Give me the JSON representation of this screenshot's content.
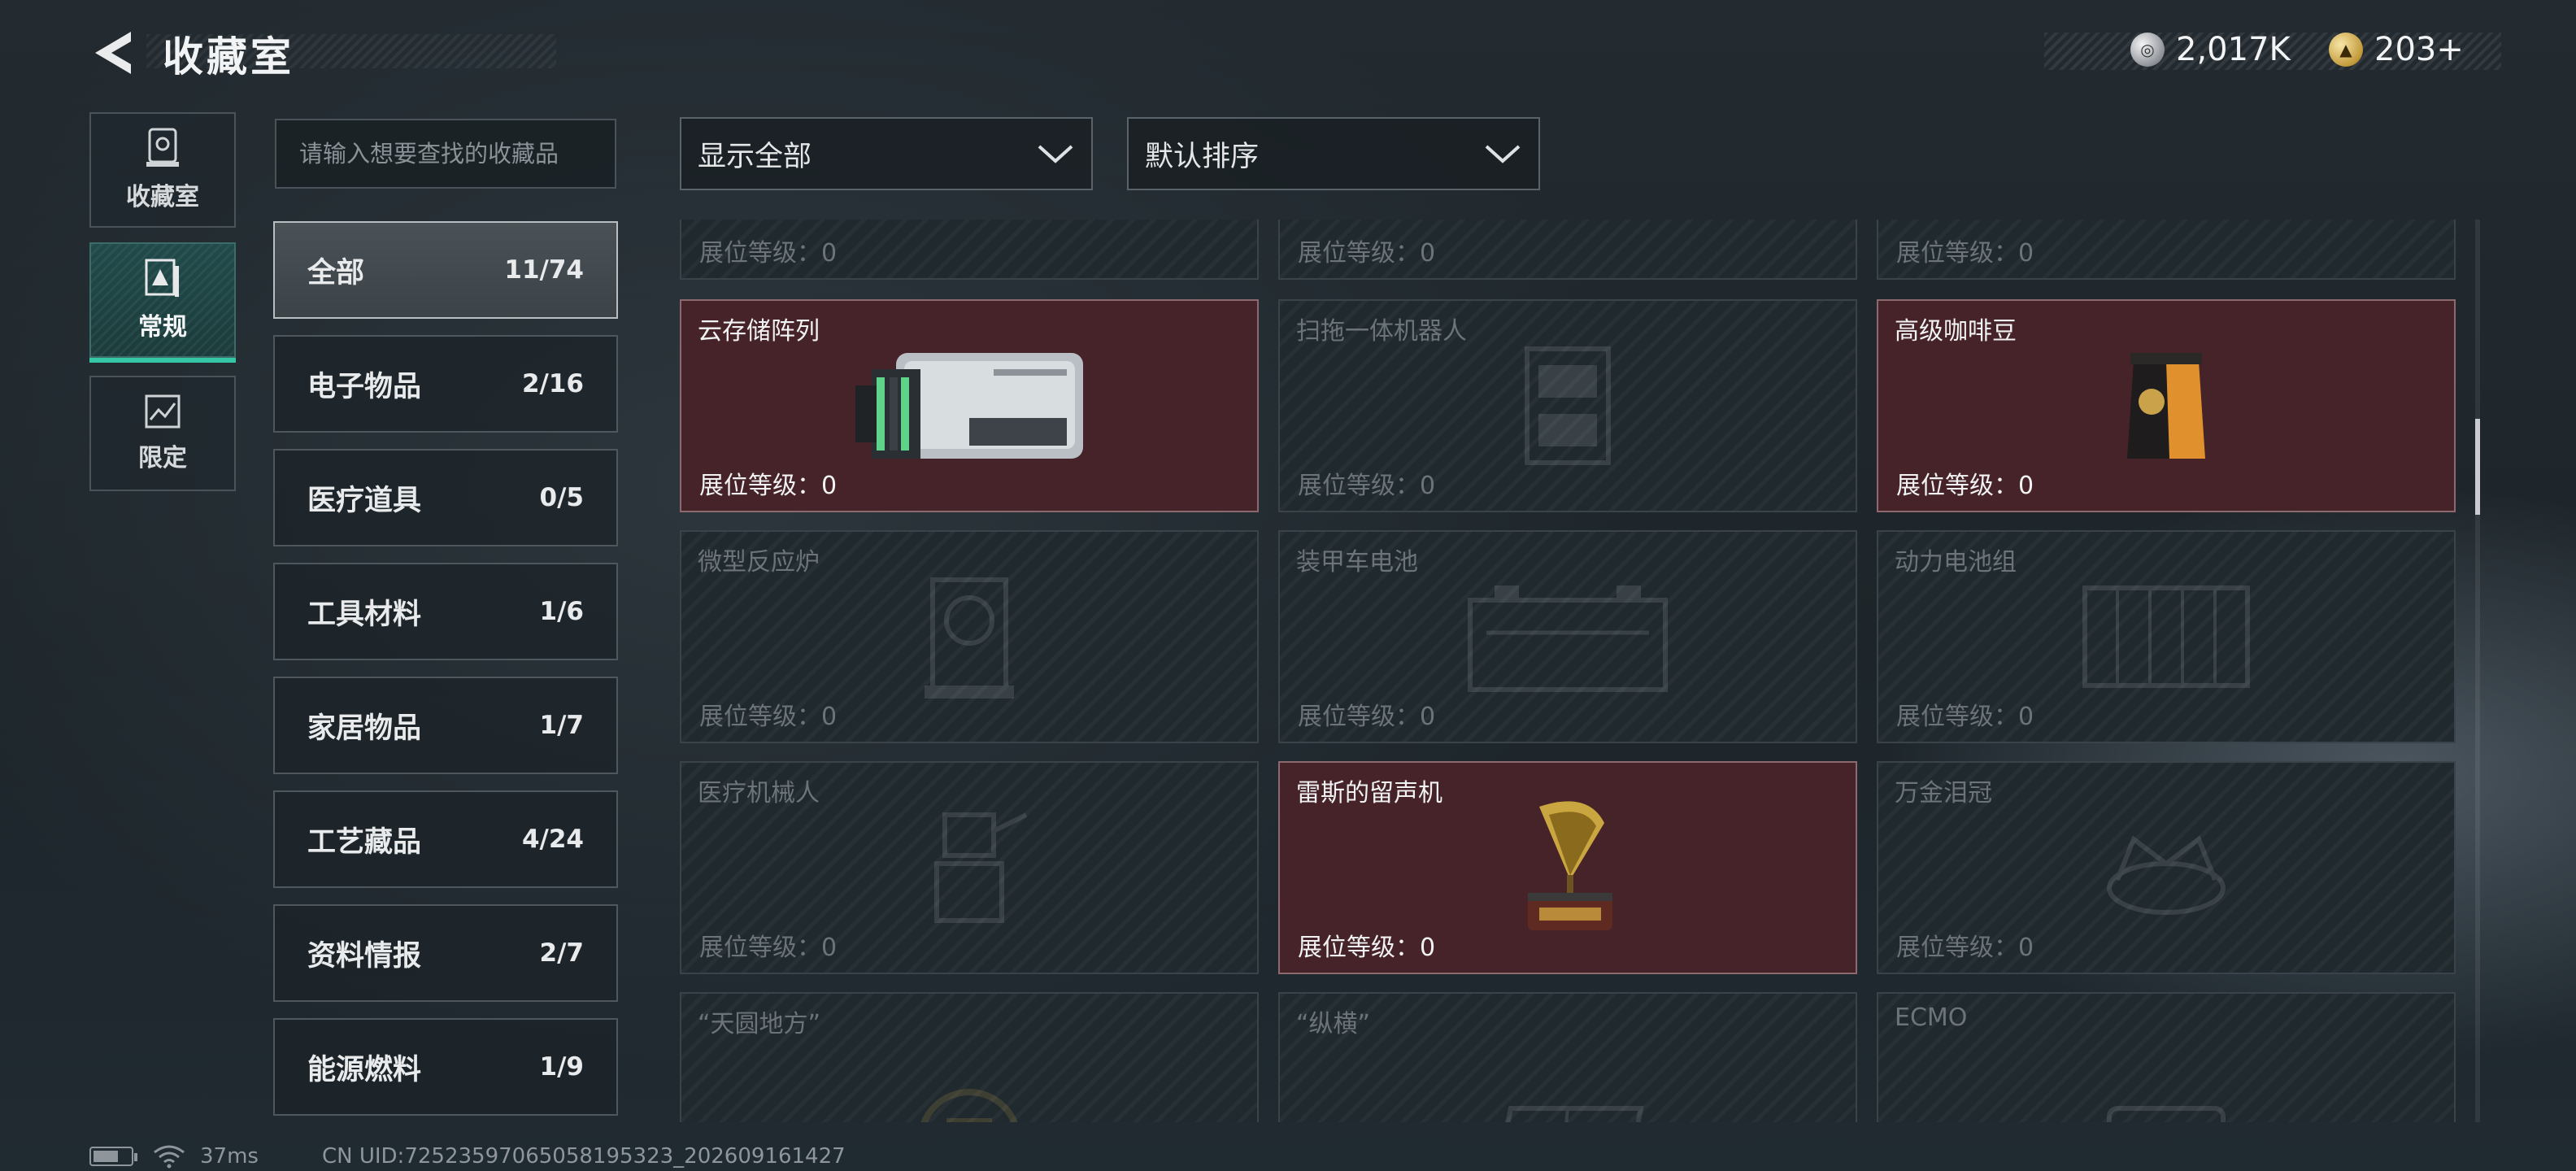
{
  "header": {
    "title": "收藏室",
    "currencies": [
      {
        "icon": "silver-coin-icon",
        "value": "2,017K"
      },
      {
        "icon": "gold-coin-icon",
        "value": "203+"
      }
    ]
  },
  "side_tabs": [
    {
      "label": "收藏室",
      "icon": "collection-room-icon",
      "active": false
    },
    {
      "label": "常规",
      "icon": "regular-icon",
      "active": true
    },
    {
      "label": "限定",
      "icon": "limited-icon",
      "active": false
    }
  ],
  "search": {
    "placeholder": "请输入想要查找的收藏品"
  },
  "categories": [
    {
      "name": "全部",
      "count": "11/74",
      "active": true
    },
    {
      "name": "电子物品",
      "count": "2/16"
    },
    {
      "name": "医疗道具",
      "count": "0/5"
    },
    {
      "name": "工具材料",
      "count": "1/6"
    },
    {
      "name": "家居物品",
      "count": "1/7"
    },
    {
      "name": "工艺藏品",
      "count": "4/24"
    },
    {
      "name": "资料情报",
      "count": "2/7"
    },
    {
      "name": "能源燃料",
      "count": "1/9"
    }
  ],
  "filters": {
    "show": {
      "value": "显示全部",
      "icon": "chevron-down-icon"
    },
    "sort": {
      "value": "默认排序",
      "icon": "chevron-down-icon"
    }
  },
  "items": [
    {
      "name": "",
      "level": "展位等级：0",
      "owned": false,
      "icon": "item-icon"
    },
    {
      "name": "",
      "level": "展位等级：0",
      "owned": false,
      "icon": "item-icon"
    },
    {
      "name": "",
      "level": "展位等级：0",
      "owned": false,
      "icon": "item-icon"
    },
    {
      "name": "云存储阵列",
      "level": "展位等级：0",
      "owned": true,
      "icon": "cloud-storage-array-icon"
    },
    {
      "name": "扫拖一体机器人",
      "level": "展位等级：0",
      "owned": false,
      "icon": "robot-vacuum-icon"
    },
    {
      "name": "高级咖啡豆",
      "level": "展位等级：0",
      "owned": true,
      "icon": "coffee-beans-icon"
    },
    {
      "name": "微型反应炉",
      "level": "展位等级：0",
      "owned": false,
      "icon": "micro-reactor-icon"
    },
    {
      "name": "装甲车电池",
      "level": "展位等级：0",
      "owned": false,
      "icon": "armored-battery-icon"
    },
    {
      "name": "动力电池组",
      "level": "展位等级：0",
      "owned": false,
      "icon": "battery-pack-icon"
    },
    {
      "name": "医疗机械人",
      "level": "展位等级：0",
      "owned": false,
      "icon": "medical-robot-icon"
    },
    {
      "name": "雷斯的留声机",
      "level": "展位等级：0",
      "owned": true,
      "icon": "gramophone-icon"
    },
    {
      "name": "万金泪冠",
      "level": "展位等级：0",
      "owned": false,
      "icon": "crown-icon"
    },
    {
      "name": "“天圆地方”",
      "level": "",
      "owned": false,
      "icon": "compass-icon"
    },
    {
      "name": "“纵横”",
      "level": "",
      "owned": false,
      "icon": "chessboard-icon"
    },
    {
      "name": "ECMO",
      "level": "",
      "owned": false,
      "icon": "ecmo-icon"
    }
  ],
  "footer": {
    "ping": "37ms",
    "uid": "CN UID:7252359706505819532​3_202609161427"
  }
}
